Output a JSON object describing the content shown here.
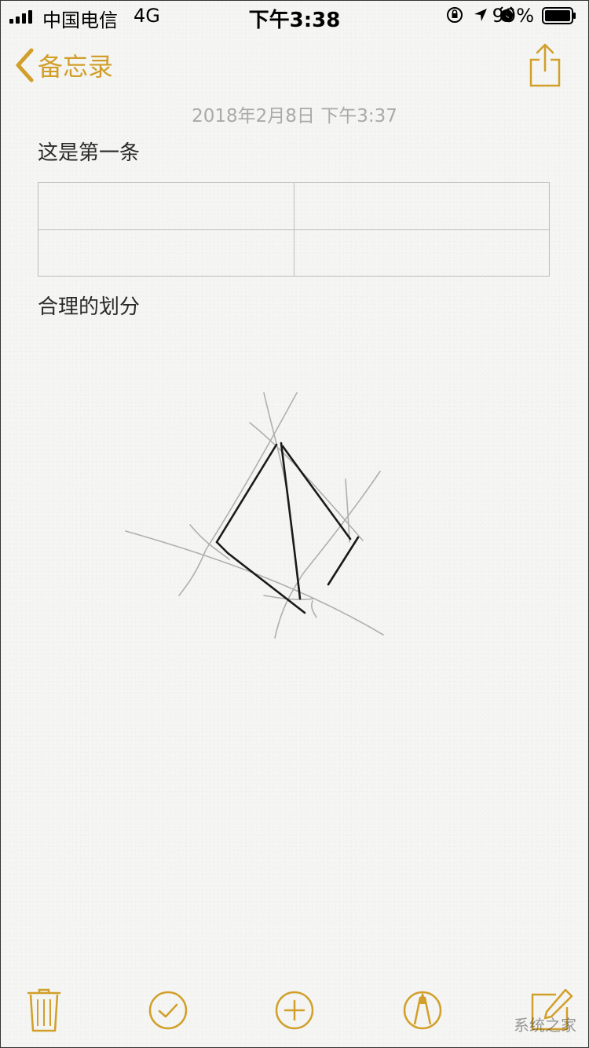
{
  "status_bar": {
    "carrier": "中国电信",
    "network": "4G",
    "time": "下午3:38",
    "battery": "99%"
  },
  "nav": {
    "back_label": "备忘录",
    "accent_color": "#d19f2a"
  },
  "note": {
    "date": "2018年2月8日 下午3:37",
    "lines": [
      "这是第一条",
      "合理的划分"
    ],
    "table": {
      "rows": 2,
      "cols": 2
    }
  },
  "toolbar": {
    "items": [
      "trash-icon",
      "checklist-icon",
      "add-icon",
      "markup-icon",
      "compose-icon"
    ]
  },
  "watermark": "系统之家"
}
